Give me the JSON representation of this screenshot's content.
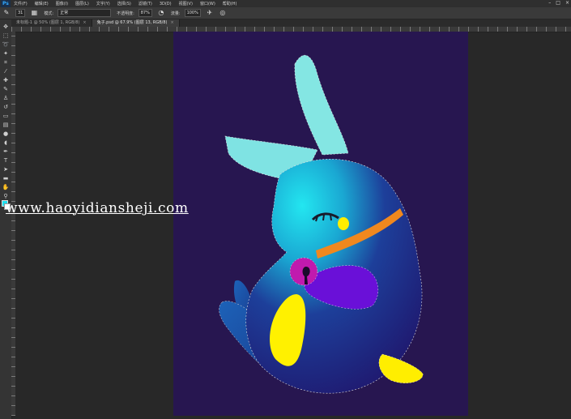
{
  "app": {
    "logo": "Ps"
  },
  "menu": {
    "items": [
      "文件(F)",
      "编辑(E)",
      "图像(I)",
      "图层(L)",
      "文字(Y)",
      "选择(S)",
      "滤镜(T)",
      "3D(D)",
      "视图(V)",
      "窗口(W)",
      "帮助(H)"
    ]
  },
  "window_controls": {
    "minimize": "–",
    "maximize": "□",
    "close": "×"
  },
  "options_bar": {
    "brush_size": "31",
    "mode_label": "模式:",
    "mode_value": "正常",
    "opacity_label": "不透明度:",
    "opacity_value": "87%",
    "flow_label": "流量:",
    "flow_value": "100%"
  },
  "tabs": [
    {
      "label": "未标题-1 @ 50% (图层 1, RGB/8)",
      "close": "×",
      "active": false
    },
    {
      "label": "兔子.psd @ 67.9% (图层 13, RGB/8)",
      "close": "×",
      "active": true
    }
  ],
  "colors": {
    "foreground": "#1ee0f0",
    "background": "#ffffff",
    "canvas": "#271650"
  },
  "watermark": {
    "text": "www.haoyidiansheji.com"
  }
}
